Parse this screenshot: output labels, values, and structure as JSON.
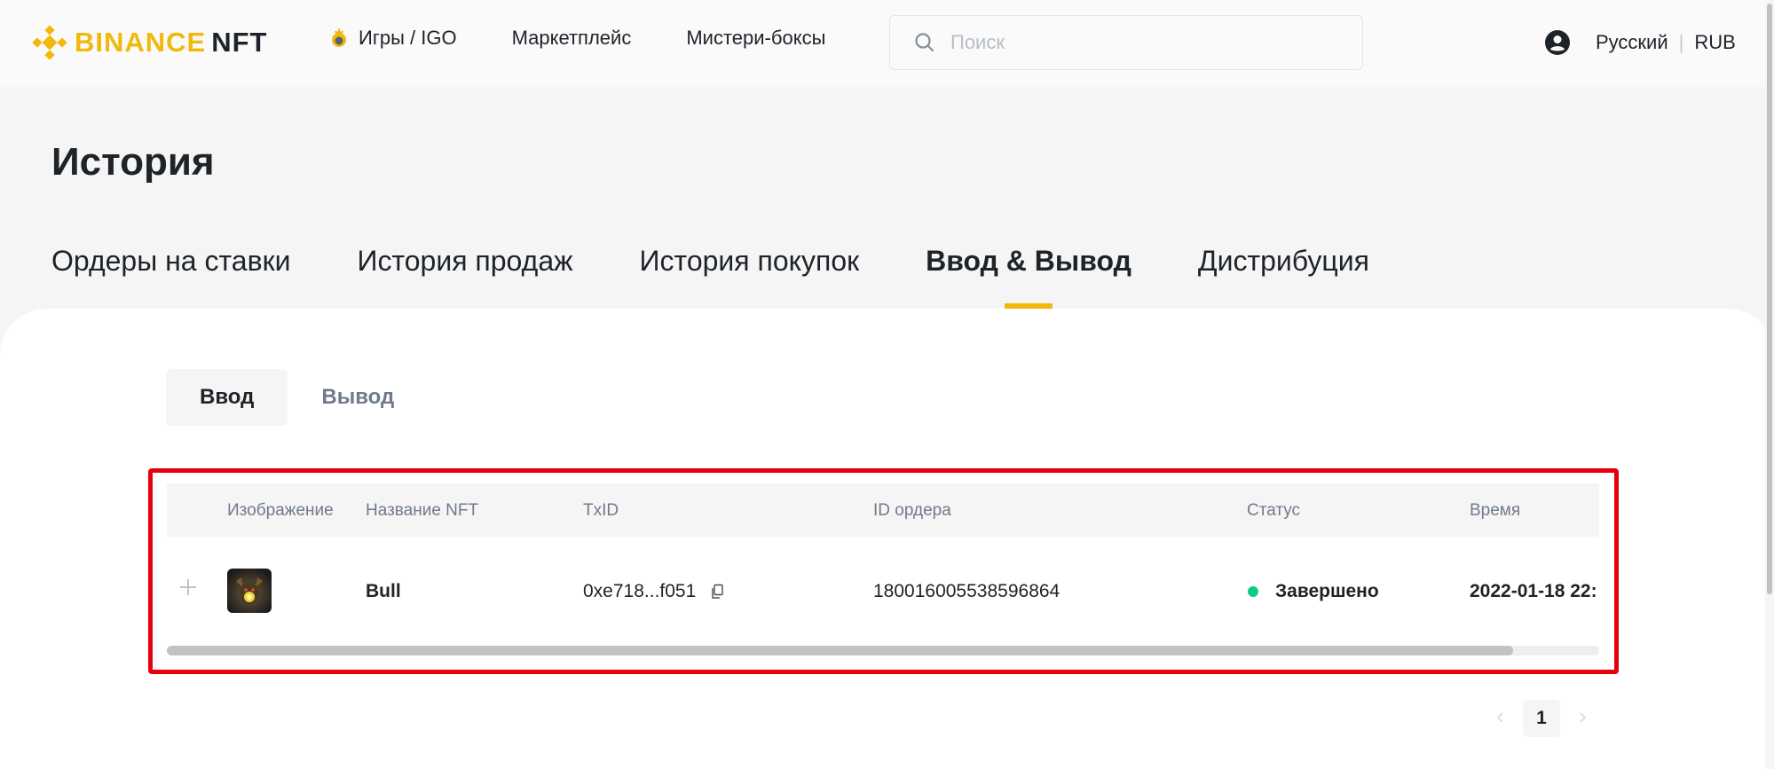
{
  "header": {
    "brand": "BINANCE",
    "brand_suffix": "NFT",
    "nav": [
      {
        "label": "Игры / IGO",
        "icon": "igo-flame-icon"
      },
      {
        "label": "Маркетплейс"
      },
      {
        "label": "Мистери-боксы"
      }
    ],
    "search_placeholder": "Поиск",
    "language": "Русский",
    "currency": "RUB"
  },
  "page": {
    "title": "История",
    "tabs": [
      {
        "label": "Ордеры на ставки",
        "active": false
      },
      {
        "label": "История продаж",
        "active": false
      },
      {
        "label": "История покупок",
        "active": false
      },
      {
        "label": "Ввод & Вывод",
        "active": true
      },
      {
        "label": "Дистрибуция",
        "active": false
      }
    ],
    "subtabs": [
      {
        "label": "Ввод",
        "active": true
      },
      {
        "label": "Вывод",
        "active": false
      }
    ]
  },
  "table": {
    "columns": [
      "Изображение",
      "Название NFT",
      "TxID",
      "ID ордера",
      "Статус",
      "Время"
    ],
    "rows": [
      {
        "nft_name": "Bull",
        "txid": "0xe718...f051",
        "order_id": "180016005538596864",
        "status": "Завершено",
        "time": "2022-01-18 22:"
      }
    ],
    "horizontal_scroll_fraction": 0.94
  },
  "pagination": {
    "current_page": "1"
  },
  "colors": {
    "brand_yellow": "#f0b90b",
    "status_success": "#0ecb81",
    "highlight_red": "#e6000e",
    "text_primary": "#1e2329",
    "text_secondary": "#707a8a"
  }
}
